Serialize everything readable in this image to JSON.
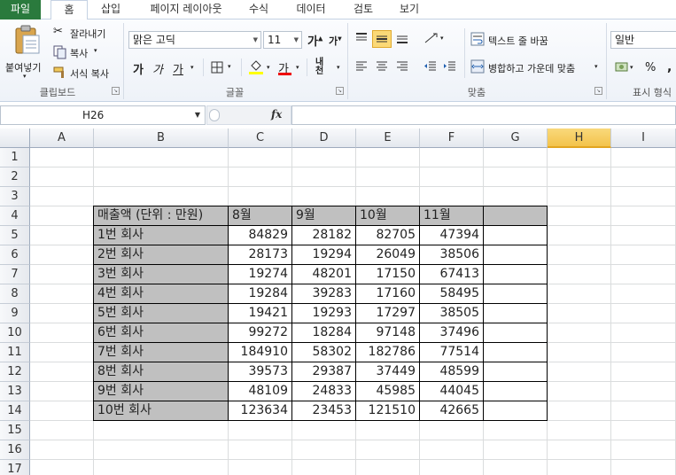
{
  "tabs": {
    "file": "파일",
    "home": "홈",
    "insert": "삽입",
    "page_layout": "페이지 레이아웃",
    "formulas": "수식",
    "data": "데이터",
    "review": "검토",
    "view": "보기"
  },
  "clipboard": {
    "paste": "붙여넣기",
    "cut": "잘라내기",
    "copy": "복사",
    "format_painter": "서식 복사",
    "label": "클립보드"
  },
  "font": {
    "name": "맑은 고딕",
    "size": "11",
    "grow": "가",
    "shrink": "가",
    "bold": "가",
    "italic": "가",
    "underline": "가",
    "font_color_glyph": "가",
    "phonetic": "내천",
    "label": "글꼴"
  },
  "alignment": {
    "wrap_text": "텍스트 줄 바꿈",
    "merge_center": "병합하고 가운데 맞춤",
    "label": "맞춤"
  },
  "number": {
    "format": "일반",
    "percent": "%",
    "comma": ",",
    "label": "표시 형식"
  },
  "formula_bar": {
    "name_box": "H26",
    "fx": "fx",
    "formula": ""
  },
  "grid": {
    "columns": [
      "A",
      "B",
      "C",
      "D",
      "E",
      "F",
      "G",
      "H",
      "I"
    ],
    "selected_column": "H",
    "rows": [
      "1",
      "2",
      "3",
      "4",
      "5",
      "6",
      "7",
      "8",
      "9",
      "10",
      "11",
      "12",
      "13",
      "14",
      "15",
      "16",
      "17"
    ],
    "table": {
      "header": [
        "매출액 (단위 : 만원)",
        "8월",
        "9월",
        "10월",
        "11월",
        ""
      ],
      "rows": [
        [
          "1번 회사",
          "84829",
          "28182",
          "82705",
          "47394",
          ""
        ],
        [
          "2번 회사",
          "28173",
          "19294",
          "26049",
          "38506",
          ""
        ],
        [
          "3번 회사",
          "19274",
          "48201",
          "17150",
          "67413",
          ""
        ],
        [
          "4번 회사",
          "19284",
          "39283",
          "17160",
          "58495",
          ""
        ],
        [
          "5번 회사",
          "19421",
          "19293",
          "17297",
          "38505",
          ""
        ],
        [
          "6번 회사",
          "99272",
          "18284",
          "97148",
          "37496",
          ""
        ],
        [
          "7번 회사",
          "184910",
          "58302",
          "182786",
          "77514",
          ""
        ],
        [
          "8번 회사",
          "39573",
          "29387",
          "37449",
          "48599",
          ""
        ],
        [
          "9번 회사",
          "48109",
          "24833",
          "45985",
          "44045",
          ""
        ],
        [
          "10번 회사",
          "123634",
          "23453",
          "121510",
          "42665",
          ""
        ]
      ]
    }
  }
}
